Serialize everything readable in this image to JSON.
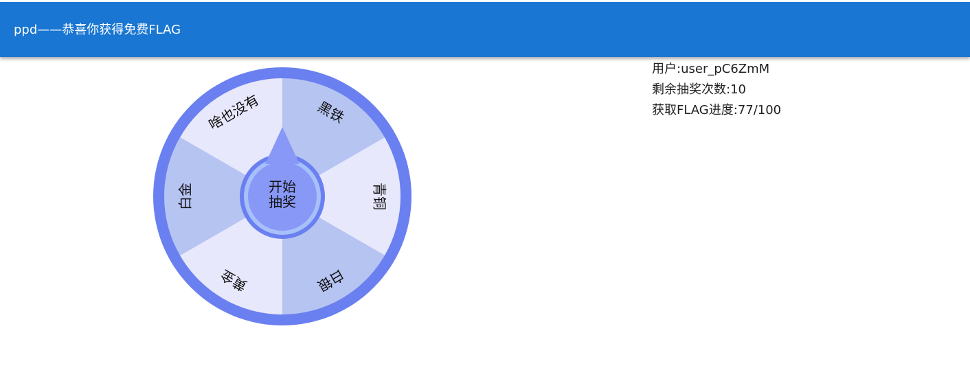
{
  "header": {
    "title": "ppd——恭喜你获得免费FLAG"
  },
  "wheel": {
    "colors": {
      "ring": "#6a80f0",
      "light": "#e8e8fc",
      "dark": "#b6c4f2",
      "center": "#8898f6",
      "center_ring": "#a8c0fa"
    },
    "prizes": [
      "黑铁",
      "青铜",
      "白银",
      "黄金",
      "白金",
      "啥也没有"
    ],
    "start_line1": "开始",
    "start_line2": "抽奖"
  },
  "info": {
    "user_label": "用户:",
    "user_value": "user_pC6ZmM",
    "remaining_label": "剩余抽奖次数:",
    "remaining_value": "10",
    "progress_label": "获取FLAG进度:",
    "progress_value": "77/100"
  }
}
